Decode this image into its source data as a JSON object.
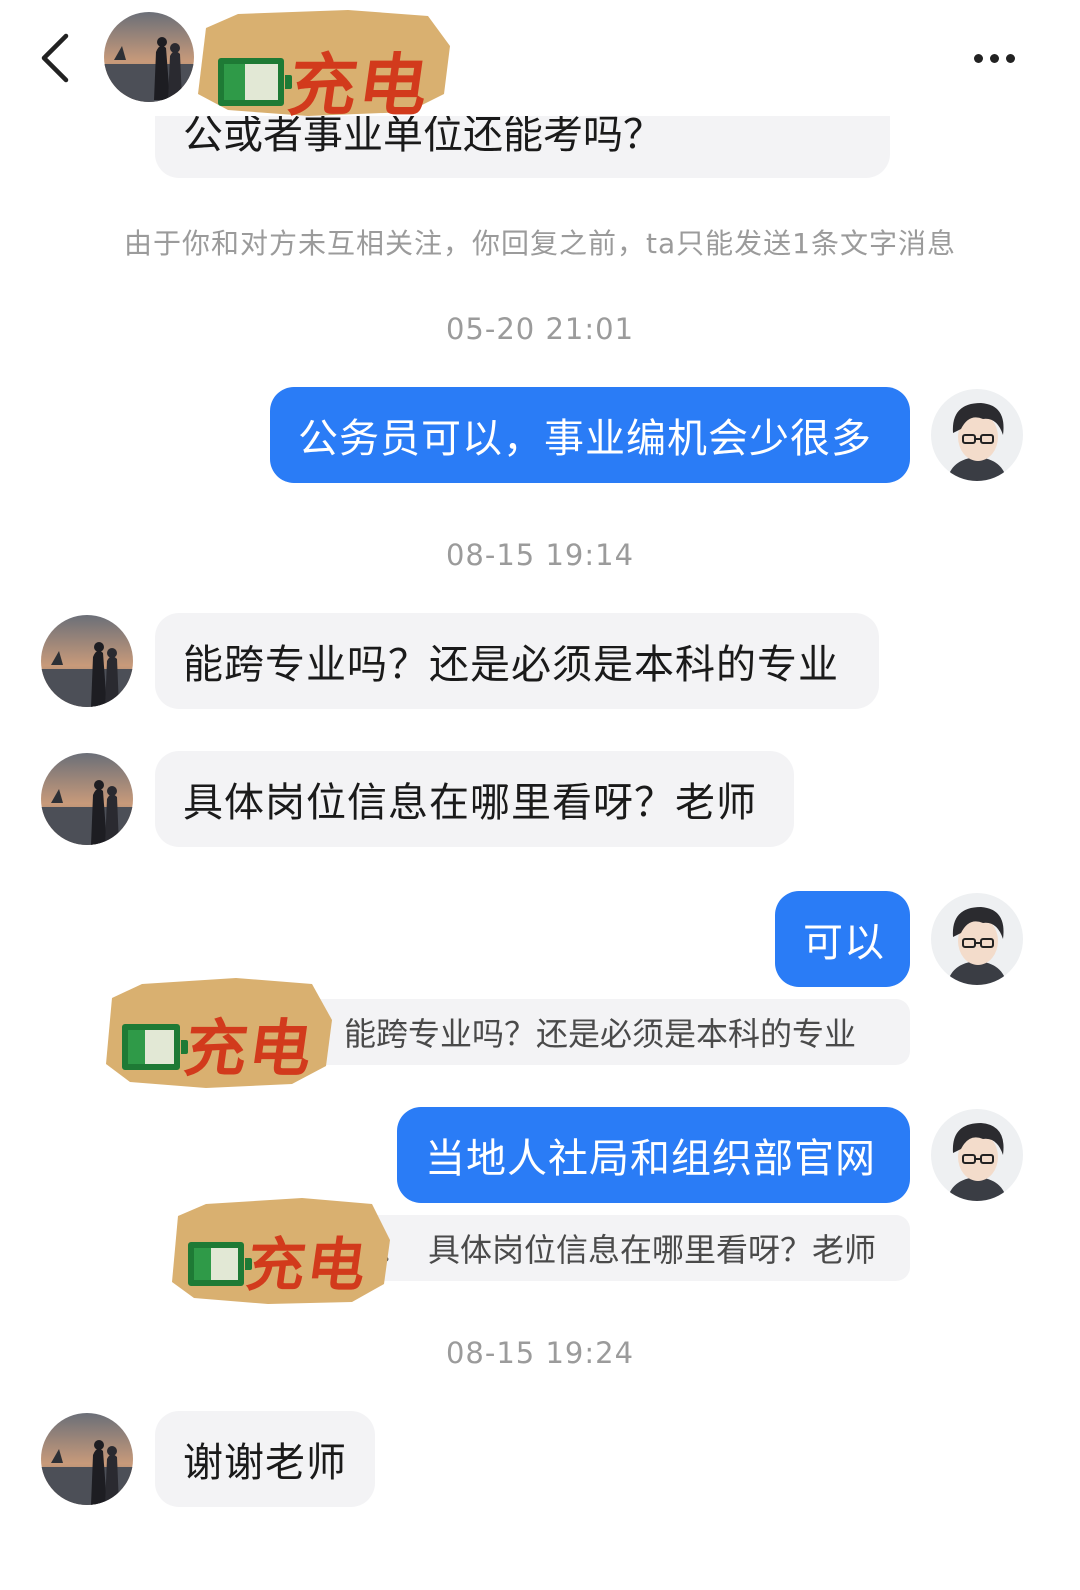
{
  "header": {
    "back_icon": "chevron-left-icon",
    "more_icon": "more-horizontal-icon",
    "contact_name_sticker": "充电"
  },
  "messages": {
    "cut_off_first": "公或者事业单位还能考吗？",
    "notice": "由于你和对方未互相关注，你回复之前，ta只能发送1条文字消息",
    "ts1": "05-20 21:01",
    "m1": "公务员可以，事业编机会少很多",
    "ts2": "08-15 19:14",
    "m2": "能跨专业吗？还是必须是本科的专业",
    "m3": "具体岗位信息在哪里看呀？老师",
    "m4": "可以",
    "q4_sticker": "充电",
    "q4_text": "能跨专业吗？还是必须是本科的专业",
    "m5": "当地人社局和组织部官网",
    "q5_sticker": "充电",
    "q5_colon": "：",
    "q5_text": "具体岗位信息在哪里看呀？老师",
    "ts3": "08-15 19:24",
    "m6": "谢谢老师"
  },
  "colors": {
    "outgoing_bubble": "#2a7cf6",
    "incoming_bubble": "#f3f3f5",
    "sticker_bg": "#d9b070",
    "sticker_text": "#d23a1c",
    "battery_green": "#2f9a48"
  }
}
